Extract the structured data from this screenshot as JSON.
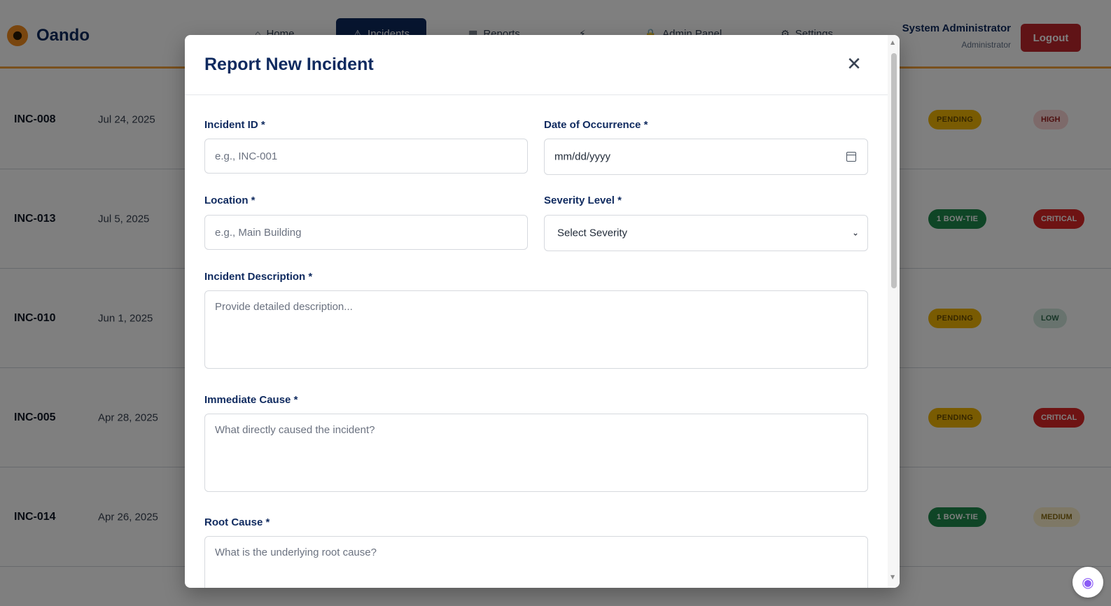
{
  "app": {
    "brand": "Oando",
    "nav": [
      {
        "icon": "home-icon",
        "glyph": "⌂",
        "label": "Home"
      },
      {
        "icon": "alert-icon",
        "glyph": "⚠",
        "label": "Incidents",
        "active": true
      },
      {
        "icon": "chart-icon",
        "glyph": "▦",
        "label": "Reports"
      },
      {
        "icon": "bolt-icon",
        "glyph": "⚡",
        "label": ""
      },
      {
        "icon": "lock-icon",
        "glyph": "🔒",
        "label": "Admin Panel"
      },
      {
        "icon": "gear-icon",
        "glyph": "⚙",
        "label": "Settings"
      }
    ],
    "user": {
      "name": "System Administrator",
      "role": "Administrator"
    },
    "logout_label": "Logout"
  },
  "incidents": [
    {
      "id": "INC-008",
      "date": "Jul 24, 2025",
      "status": "PENDING",
      "status_type": "pending",
      "severity": "HIGH",
      "severity_type": "high"
    },
    {
      "id": "INC-013",
      "date": "Jul 5, 2025",
      "status": "1 BOW-TIE",
      "status_type": "bowtie",
      "severity": "CRITICAL",
      "severity_type": "critical"
    },
    {
      "id": "INC-010",
      "date": "Jun 1, 2025",
      "status": "PENDING",
      "status_type": "pending",
      "severity": "LOW",
      "severity_type": "low"
    },
    {
      "id": "INC-005",
      "date": "Apr 28, 2025",
      "status": "PENDING",
      "status_type": "pending",
      "severity": "CRITICAL",
      "severity_type": "critical"
    },
    {
      "id": "INC-014",
      "date": "Apr 26, 2025",
      "status": "1 BOW-TIE",
      "status_type": "bowtie",
      "severity": "MEDIUM",
      "severity_type": "medium"
    }
  ],
  "modal": {
    "title": "Report New Incident",
    "close_glyph": "✕",
    "fields": {
      "incident_id": {
        "label": "Incident ID",
        "required": "*",
        "placeholder": "e.g., INC-001"
      },
      "date": {
        "label": "Date of Occurrence",
        "required": "*",
        "value": "mm/dd/yyyy"
      },
      "location": {
        "label": "Location",
        "required": "*",
        "placeholder": "e.g., Main Building"
      },
      "severity": {
        "label": "Severity Level",
        "required": "*",
        "selected": "Select Severity"
      },
      "description": {
        "label": "Incident Description",
        "required": "*",
        "placeholder": "Provide detailed description..."
      },
      "immediate_cause": {
        "label": "Immediate Cause",
        "required": "*",
        "placeholder": "What directly caused the incident?"
      },
      "root_cause": {
        "label": "Root Cause",
        "required": "*",
        "placeholder": "What is the underlying root cause?"
      }
    }
  },
  "colors": {
    "brand_navy": "#0f2a5f",
    "accent_orange": "#f3a03a",
    "logout_red": "#c1272d"
  }
}
